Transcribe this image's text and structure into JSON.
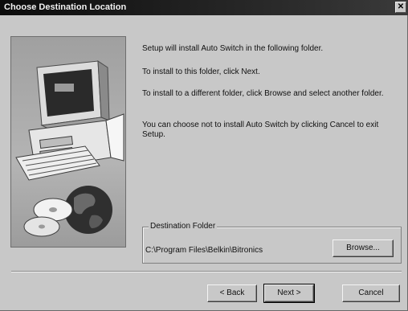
{
  "window": {
    "title": "Choose Destination Location"
  },
  "body": {
    "line1": "Setup will install Auto Switch in the following folder.",
    "line2": "To install to this folder, click Next.",
    "line3": "To install to a different folder, click Browse and select another folder.",
    "line4": "You can choose not to install Auto Switch by clicking Cancel to exit Setup."
  },
  "destination": {
    "legend": "Destination Folder",
    "path": "C:\\Program Files\\Belkin\\Bitronics",
    "browse_label": "Browse..."
  },
  "footer": {
    "back_label": "< Back",
    "next_label": "Next >",
    "cancel_label": "Cancel"
  },
  "icons": [
    "close-icon",
    "computer-icon",
    "monitor-icon",
    "keyboard-icon",
    "cd-icon",
    "globe-icon"
  ],
  "colors": {
    "titlebar": "#0c0c0c",
    "dialog_bg": "#c8c8c8"
  }
}
